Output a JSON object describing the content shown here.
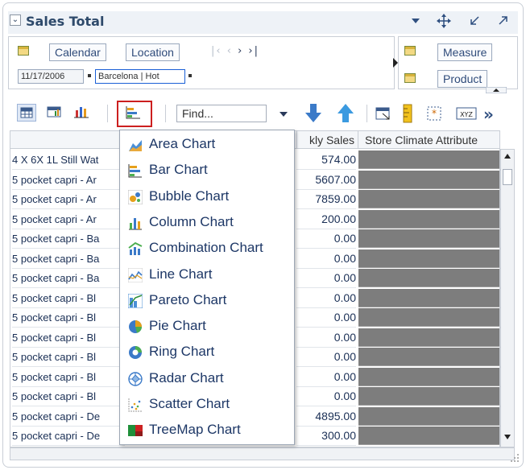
{
  "panel": {
    "title": "Sales Total",
    "collapse_glyph": "⌄",
    "title_icons": [
      "dropdown-arrow-icon",
      "move-icon",
      "minimize-icon",
      "maximize-icon"
    ]
  },
  "pivot": {
    "row_edge": [
      "Calendar",
      "Location"
    ],
    "page_items": [
      "11/17/2006",
      "Barcelona | Hot"
    ],
    "column_edge": [
      "Measure",
      "Product"
    ]
  },
  "toolbar": {
    "find_placeholder": "Find...",
    "overflow": "»"
  },
  "table": {
    "headers": {
      "weekly_sales": "kly Sales",
      "store_climate": "Store Climate Attribute"
    },
    "rows": [
      {
        "name": "4 X 6X 1L Still Wat",
        "value": "574.00"
      },
      {
        "name": "5 pocket capri - Ar",
        "value": "5607.00"
      },
      {
        "name": "5 pocket capri - Ar",
        "value": "7859.00"
      },
      {
        "name": "5 pocket capri - Ar",
        "value": "200.00"
      },
      {
        "name": "5 pocket capri - Ba",
        "value": "0.00"
      },
      {
        "name": "5 pocket capri - Ba",
        "value": "0.00"
      },
      {
        "name": "5 pocket capri - Ba",
        "value": "0.00"
      },
      {
        "name": "5 pocket capri - Bl",
        "value": "0.00"
      },
      {
        "name": "5 pocket capri - Bl",
        "value": "0.00"
      },
      {
        "name": "5 pocket capri - Bl",
        "value": "0.00"
      },
      {
        "name": "5 pocket capri - Bl",
        "value": "0.00"
      },
      {
        "name": "5 pocket capri - Bl",
        "value": "0.00"
      },
      {
        "name": "5 pocket capri - Bl",
        "value": "0.00"
      },
      {
        "name": "5 pocket capri - De",
        "value": "4895.00"
      },
      {
        "name": "5 pocket capri - De",
        "value": "300.00"
      }
    ]
  },
  "chart_menu": {
    "items": [
      {
        "label": "Area Chart",
        "icon": "area-chart-icon"
      },
      {
        "label": "Bar Chart",
        "icon": "bar-chart-icon"
      },
      {
        "label": "Bubble Chart",
        "icon": "bubble-chart-icon"
      },
      {
        "label": "Column Chart",
        "icon": "column-chart-icon"
      },
      {
        "label": "Combination Chart",
        "icon": "combination-chart-icon"
      },
      {
        "label": "Line Chart",
        "icon": "line-chart-icon"
      },
      {
        "label": "Pareto Chart",
        "icon": "pareto-chart-icon"
      },
      {
        "label": "Pie Chart",
        "icon": "pie-chart-icon"
      },
      {
        "label": "Ring Chart",
        "icon": "ring-chart-icon"
      },
      {
        "label": "Radar Chart",
        "icon": "radar-chart-icon"
      },
      {
        "label": "Scatter Chart",
        "icon": "scatter-chart-icon"
      },
      {
        "label": "TreeMap Chart",
        "icon": "treemap-chart-icon"
      }
    ]
  },
  "colors": {
    "highlight": "#cc1f1f",
    "title": "#2e4a6b",
    "attribute_cell": "#7d7d7d"
  }
}
